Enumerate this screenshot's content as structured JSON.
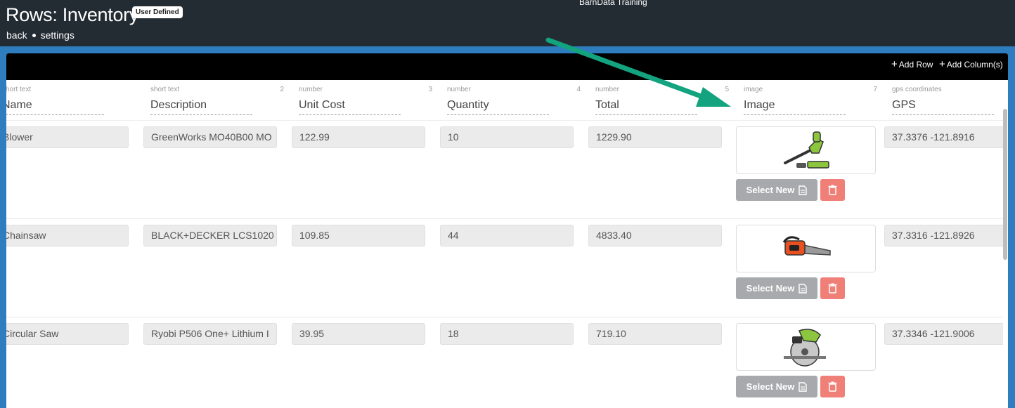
{
  "header": {
    "title": "Rows: Inventory",
    "badge": "User Defined",
    "app_name": "BarnData Training",
    "breadcrumbs": [
      "back",
      "settings"
    ]
  },
  "toolbar": {
    "add_row": "Add Row",
    "add_columns": "Add Column(s)"
  },
  "columns": [
    {
      "type": "short text",
      "num": "",
      "name": "Name"
    },
    {
      "type": "short text",
      "num": "2",
      "name": "Description"
    },
    {
      "type": "number",
      "num": "3",
      "name": "Unit Cost"
    },
    {
      "type": "number",
      "num": "4",
      "name": "Quantity"
    },
    {
      "type": "number",
      "num": "5",
      "name": "Total"
    },
    {
      "type": "image",
      "num": "7",
      "name": "Image"
    },
    {
      "type": "gps coordinates",
      "num": "",
      "name": "GPS"
    }
  ],
  "rows": [
    {
      "name": "Blower",
      "description": "GreenWorks MO40B00 MO",
      "unit_cost": "122.99",
      "quantity": "10",
      "total": "1229.90",
      "image": "leaf-blower",
      "gps": "37.3376 -121.8916"
    },
    {
      "name": "Chainsaw",
      "description": "BLACK+DECKER LCS1020",
      "unit_cost": "109.85",
      "quantity": "44",
      "total": "4833.40",
      "image": "chainsaw",
      "gps": "37.3316 -121.8926"
    },
    {
      "name": "Circular Saw",
      "description": "Ryobi P506 One+ Lithium I",
      "unit_cost": "39.95",
      "quantity": "18",
      "total": "719.10",
      "image": "circular-saw",
      "gps": "37.3346 -121.9006"
    }
  ],
  "image_actions": {
    "select_new": "Select New"
  },
  "colors": {
    "header_bg": "#232b33",
    "blue_band": "#2e7dbf",
    "delete_btn": "#f07f77",
    "select_btn": "#a7a9ac",
    "annotation_arrow": "#13a37f"
  }
}
